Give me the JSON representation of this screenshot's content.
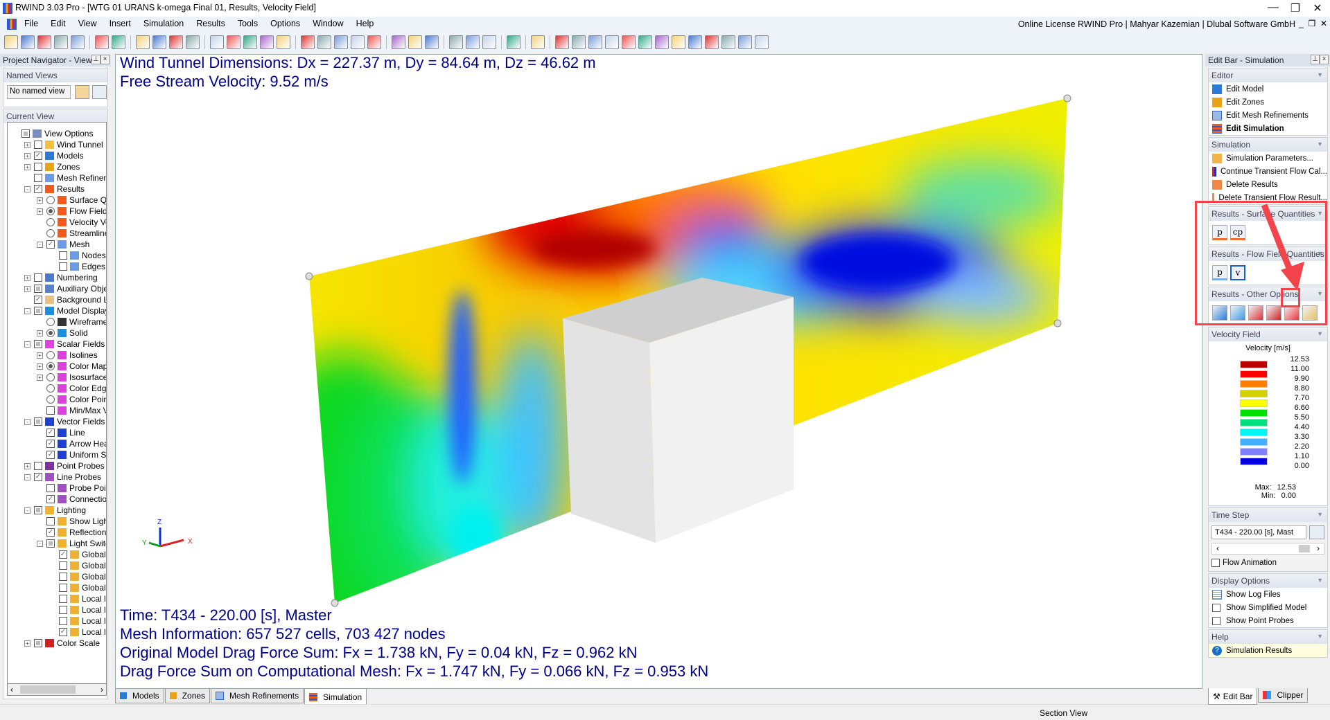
{
  "window": {
    "title": "RWIND 3.03 Pro - [WTG 01 URANS k-omega Final 01, Results, Velocity Field]",
    "license": "Online License RWIND Pro | Mahyar Kazemian | Dlubal Software GmbH"
  },
  "menu": [
    "File",
    "Edit",
    "View",
    "Insert",
    "Simulation",
    "Results",
    "Tools",
    "Options",
    "Window",
    "Help"
  ],
  "toolbar_icons": [
    "new-icon",
    "open-icon",
    "save-icon",
    "properties-icon",
    "print-icon",
    "|",
    "undo-icon",
    "redo-icon",
    "|",
    "select-icon",
    "view-icon",
    "pick-icon",
    "grid-icon",
    "|",
    "model-red-icon",
    "model-x-icon",
    "rotate-icon",
    "rotate2-icon",
    "rotate3-icon",
    "|",
    "iso-view-icon",
    "view2-icon",
    "view3-icon",
    "zoom-icon",
    "zoom-all-icon",
    "|",
    "rotate-cw-icon",
    "rotate-ccw-icon",
    "rotate-back-icon",
    "|",
    "wireframe-icon",
    "box-icon",
    "axes-icon",
    "|",
    "cube-icon",
    "|",
    "color-map-icon",
    "|",
    "t1-icon",
    "t2-icon",
    "t3-icon",
    "t4-icon",
    "t5-icon",
    "t6-icon",
    "t7-icon",
    "t8-icon",
    "t9-icon",
    "t10-icon",
    "t11-icon",
    "t12-icon",
    "t13-icon"
  ],
  "navigator": {
    "title": "Project Navigator - View",
    "named_views": "Named Views",
    "named_view_value": "No named view",
    "current_view": "Current View",
    "tree": [
      {
        "label": "View Options",
        "d": 0,
        "c": "partial",
        "e": "",
        "i": "view"
      },
      {
        "label": "Wind Tunnel",
        "d": 1,
        "c": "off",
        "e": "+",
        "i": "tunnel"
      },
      {
        "label": "Models",
        "d": 1,
        "c": "on",
        "e": "+",
        "i": "model"
      },
      {
        "label": "Zones",
        "d": 1,
        "c": "off",
        "e": "+",
        "i": "zone"
      },
      {
        "label": "Mesh Refinement",
        "d": 1,
        "c": "off",
        "e": "",
        "i": "mesh"
      },
      {
        "label": "Results",
        "d": 1,
        "c": "on",
        "e": "-",
        "i": "results"
      },
      {
        "label": "Surface Quan",
        "d": 2,
        "r": "off",
        "e": "+",
        "i": "results"
      },
      {
        "label": "Flow Field Qu",
        "d": 2,
        "r": "on",
        "e": "+",
        "i": "results"
      },
      {
        "label": "Velocity Vect",
        "d": 2,
        "r": "off",
        "e": "",
        "i": "results"
      },
      {
        "label": "Streamlines",
        "d": 2,
        "r": "off",
        "e": "",
        "i": "results"
      },
      {
        "label": "Mesh",
        "d": 2,
        "c": "on",
        "e": "-",
        "i": "mesh"
      },
      {
        "label": "Nodes",
        "d": 3,
        "c": "off",
        "e": "",
        "i": "mesh"
      },
      {
        "label": "Edges",
        "d": 3,
        "c": "off",
        "e": "",
        "i": "mesh"
      },
      {
        "label": "Numbering",
        "d": 1,
        "c": "off",
        "e": "+",
        "i": "numbering"
      },
      {
        "label": "Auxiliary Objects",
        "d": 1,
        "c": "partial",
        "e": "+",
        "i": "aux"
      },
      {
        "label": "Background Laye",
        "d": 1,
        "c": "on",
        "e": "",
        "i": "layers"
      },
      {
        "label": "Model Display",
        "d": 1,
        "c": "partial",
        "e": "-",
        "i": "solid"
      },
      {
        "label": "Wireframe",
        "d": 2,
        "r": "off",
        "e": "",
        "i": "wire"
      },
      {
        "label": "Solid",
        "d": 2,
        "r": "on",
        "e": "+",
        "i": "solid"
      },
      {
        "label": "Scalar Fields",
        "d": 1,
        "c": "partial",
        "e": "-",
        "i": "scalar"
      },
      {
        "label": "Isolines",
        "d": 2,
        "r": "off",
        "e": "+",
        "i": "scalar"
      },
      {
        "label": "Color Map",
        "d": 2,
        "r": "on",
        "e": "+",
        "i": "scalar"
      },
      {
        "label": "Isosurfaces",
        "d": 2,
        "r": "off",
        "e": "+",
        "i": "scalar"
      },
      {
        "label": "Color Edges",
        "d": 2,
        "r": "off",
        "e": "",
        "i": "scalar"
      },
      {
        "label": "Color Points",
        "d": 2,
        "r": "off",
        "e": "",
        "i": "scalar"
      },
      {
        "label": "Min/Max Valu",
        "d": 2,
        "c": "off",
        "e": "",
        "i": "scalar"
      },
      {
        "label": "Vector Fields",
        "d": 1,
        "c": "partial",
        "e": "-",
        "i": "vector"
      },
      {
        "label": "Line",
        "d": 2,
        "c": "on",
        "e": "",
        "i": "vector"
      },
      {
        "label": "Arrow Head",
        "d": 2,
        "c": "on",
        "e": "",
        "i": "vector"
      },
      {
        "label": "Uniform Size",
        "d": 2,
        "c": "on",
        "e": "",
        "i": "vector"
      },
      {
        "label": "Point Probes",
        "d": 1,
        "c": "off",
        "e": "+",
        "i": "probe"
      },
      {
        "label": "Line Probes",
        "d": 1,
        "c": "on",
        "e": "-",
        "i": "lprobe"
      },
      {
        "label": "Probe Points",
        "d": 2,
        "c": "off",
        "e": "",
        "i": "lprobe"
      },
      {
        "label": "Connection L",
        "d": 2,
        "c": "on",
        "e": "",
        "i": "lprobe"
      },
      {
        "label": "Lighting",
        "d": 1,
        "c": "partial",
        "e": "-",
        "i": "light"
      },
      {
        "label": "Show Light S",
        "d": 2,
        "c": "off",
        "e": "",
        "i": "light"
      },
      {
        "label": "Reflection on",
        "d": 2,
        "c": "on",
        "e": "",
        "i": "light"
      },
      {
        "label": "Light Switche",
        "d": 2,
        "c": "partial",
        "e": "-",
        "i": "light"
      },
      {
        "label": "Global lig",
        "d": 3,
        "c": "on",
        "e": "",
        "i": "light"
      },
      {
        "label": "Global lig",
        "d": 3,
        "c": "off",
        "e": "",
        "i": "light"
      },
      {
        "label": "Global lig",
        "d": 3,
        "c": "off",
        "e": "",
        "i": "light"
      },
      {
        "label": "Global lig",
        "d": 3,
        "c": "off",
        "e": "",
        "i": "light"
      },
      {
        "label": "Local ligh",
        "d": 3,
        "c": "off",
        "e": "",
        "i": "light"
      },
      {
        "label": "Local ligh",
        "d": 3,
        "c": "off",
        "e": "",
        "i": "light"
      },
      {
        "label": "Local ligh",
        "d": 3,
        "c": "off",
        "e": "",
        "i": "light"
      },
      {
        "label": "Local ligh",
        "d": 3,
        "c": "on",
        "e": "",
        "i": "light"
      },
      {
        "label": "Color Scale",
        "d": 1,
        "c": "partial",
        "e": "+",
        "i": "scale"
      }
    ]
  },
  "viewport": {
    "line1": "Wind Tunnel Dimensions: Dx = 227.37 m, Dy = 84.64 m, Dz = 46.62 m",
    "line2": "Free Stream Velocity: 9.52 m/s",
    "line3": "Time: T434 - 220.00 [s], Master",
    "line4": "Mesh Information: 657 527 cells, 703 427 nodes",
    "line5": "Original Model Drag Force Sum: Fx = 1.738 kN, Fy = 0.04 kN, Fz = 0.962 kN",
    "line6": "Drag Force Sum on Computational Mesh: Fx = 1.747 kN, Fy = 0.066 kN, Fz = 0.953 kN",
    "axes": {
      "x": "X",
      "y": "Y",
      "z": "Z"
    }
  },
  "bottom_tabs": [
    "Models",
    "Zones",
    "Mesh Refinements",
    "Simulation"
  ],
  "status": {
    "section": "Section View"
  },
  "editbar": {
    "title": "Edit Bar - Simulation",
    "editor": {
      "title": "Editor",
      "items": [
        "Edit Model",
        "Edit Zones",
        "Edit Mesh Refinements",
        "Edit Simulation"
      ]
    },
    "simulation": {
      "title": "Simulation",
      "items": [
        "Simulation Parameters...",
        "Continue Transient Flow Cal...",
        "Delete Results",
        "Delete Transient Flow Result..."
      ]
    },
    "surface": {
      "title": "Results - Surface Quantities",
      "buttons": [
        "p",
        "cp"
      ]
    },
    "flow": {
      "title": "Results - Flow Field Quantities",
      "buttons": [
        "p",
        "v"
      ]
    },
    "other": {
      "title": "Results - Other Options",
      "buttons": [
        "streamlines-icon",
        "isosurface-icon",
        "diagram-icon",
        "grid-line-icon",
        "w-icon",
        "layer-icon"
      ]
    },
    "velocity": {
      "title": "Velocity Field",
      "legend_title": "Velocity [m/s]",
      "values": [
        "12.53",
        "11.00",
        "9.90",
        "8.80",
        "7.70",
        "6.60",
        "5.50",
        "4.40",
        "3.30",
        "2.20",
        "1.10",
        "0.00"
      ],
      "colors": [
        "#b80000",
        "#ff0000",
        "#ff8000",
        "#d4d000",
        "#ffff00",
        "#00e000",
        "#00e080",
        "#00f4f4",
        "#40b0ff",
        "#8080ff",
        "#0000e0"
      ],
      "max_label": "Max:",
      "max": "12.53",
      "min_label": "Min:",
      "min": "0.00"
    },
    "timestep": {
      "title": "Time Step",
      "value": "T434 - 220.00 [s], Mast",
      "flow_animation": "Flow Animation"
    },
    "display": {
      "title": "Display Options",
      "items": [
        "Show Log Files",
        "Show Simplified Model",
        "Show Point Probes"
      ]
    },
    "help": {
      "title": "Help",
      "item": "Simulation Results"
    },
    "tabs": [
      "Edit Bar",
      "Clipper"
    ]
  },
  "accent": "#f2444a"
}
